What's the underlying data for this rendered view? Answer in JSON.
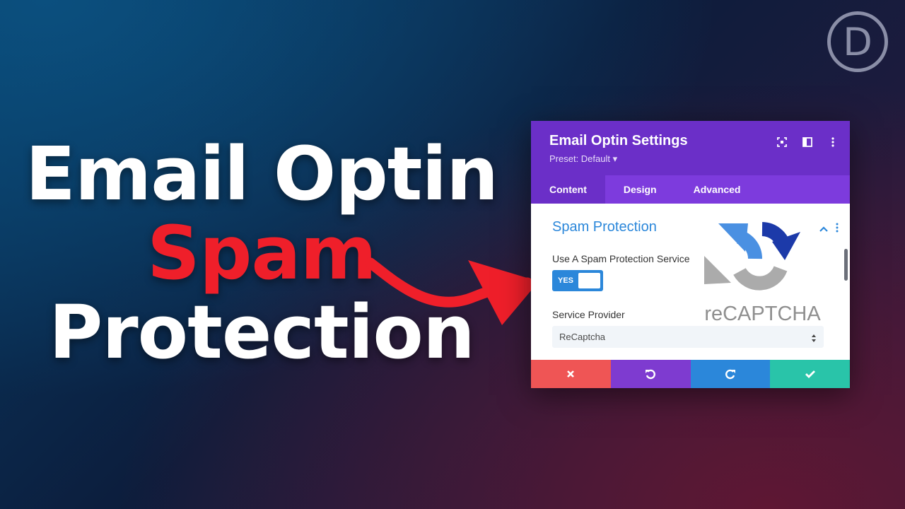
{
  "headline": {
    "line1": "Email Optin",
    "line2": "Spam",
    "line3": "Protection"
  },
  "logo": {
    "letter": "D",
    "icon": "divi-logo-icon"
  },
  "panel": {
    "title": "Email Optin Settings",
    "preset": "Preset: Default ▾",
    "header_icons": [
      "focus-icon",
      "split-view-icon",
      "more-vertical-icon"
    ],
    "tabs": [
      {
        "label": "Content",
        "active": true
      },
      {
        "label": "Design",
        "active": false
      },
      {
        "label": "Advanced",
        "active": false
      }
    ],
    "section": {
      "title": "Spam Protection",
      "spam_toggle_label": "Use A Spam Protection Service",
      "toggle_value": "YES",
      "provider_label": "Service Provider",
      "provider_value": "ReCaptcha"
    },
    "recaptcha_text": "reCAPTCHA",
    "footer_buttons": [
      "close-icon",
      "undo-icon",
      "redo-icon",
      "check-icon"
    ]
  },
  "colors": {
    "header_purple": "#6b2fc8",
    "tab_purple": "#7d3bdd",
    "accent_blue": "#2b87da",
    "headline_red": "#ef1f2a",
    "cancel_red": "#ef5555",
    "save_green": "#29c4a9"
  }
}
